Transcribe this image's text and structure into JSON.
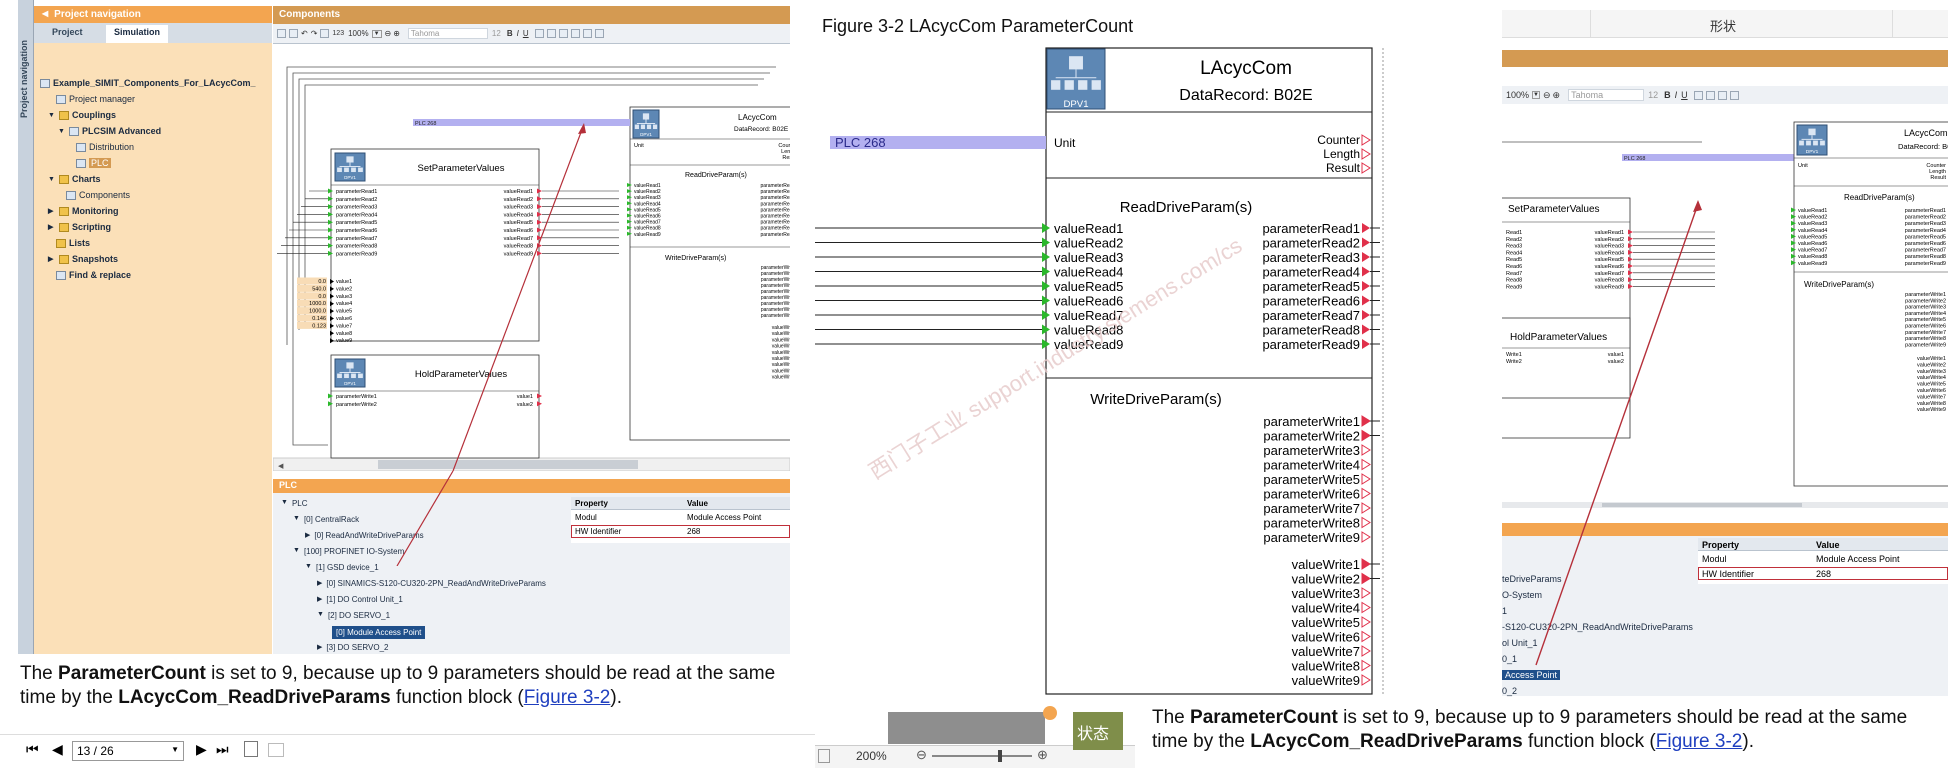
{
  "left_ide": {
    "nav_header": "Project navigation",
    "nav_vertical": "Project navigation",
    "tabs": [
      "Project",
      "Simulation"
    ],
    "tree": [
      {
        "label": "Example_SIMIT_Components_For_LAcycCom_",
        "bold": true
      },
      {
        "label": "Project manager",
        "bold": false
      },
      {
        "label": "Couplings",
        "bold": true
      },
      {
        "label": "PLCSIM Advanced",
        "bold": true
      },
      {
        "label": "Distribution",
        "bold": false
      },
      {
        "label": "PLC",
        "bold": false
      },
      {
        "label": "Charts",
        "bold": true
      },
      {
        "label": "Components",
        "bold": false
      },
      {
        "label": "Monitoring",
        "bold": true
      },
      {
        "label": "Scripting",
        "bold": true
      },
      {
        "label": "Lists",
        "bold": true
      },
      {
        "label": "Snapshots",
        "bold": true
      },
      {
        "label": "Find & replace",
        "bold": true
      }
    ],
    "components_header": "Components",
    "zoom": "100%",
    "font_name": "Tahoma",
    "font_size": "12",
    "toolbar_misc": {
      "num": "123",
      "b": "B",
      "i": "I",
      "u": "U"
    },
    "set_block": {
      "title": "SetParameterValues",
      "badge": "DPV1",
      "inputs": [
        "parameterRead1",
        "parameterRead2",
        "parameterRead3",
        "parameterRead4",
        "parameterRead5",
        "parameterRead6",
        "parameterRead7",
        "parameterRead8",
        "parameterRead9"
      ],
      "outputs": [
        "valueRead1",
        "valueRead2",
        "valueRead3",
        "valueRead4",
        "valueRead5",
        "valueRead6",
        "valueRead7",
        "valueRead8",
        "valueRead9"
      ]
    },
    "value_numbers": [
      "0.0",
      "540.0",
      "0.0",
      "1000.0",
      "1000.0",
      "0.146",
      "0.123"
    ],
    "value_labels": [
      "value1",
      "value2",
      "value3",
      "value4",
      "value5",
      "value6",
      "value7",
      "value8",
      "value9"
    ],
    "hold_block": {
      "title": "HoldParameterValues",
      "badge": "DPV1",
      "inputs": [
        "parameterWrite1",
        "parameterWrite2"
      ],
      "outputs": [
        "value1",
        "value2"
      ]
    },
    "lacyc": {
      "title": "LAcycCom",
      "subtitle": "DataRecord: B02E",
      "badge": "DPV1",
      "unit": "Unit",
      "counters": [
        "Counter",
        "Length",
        "Result"
      ],
      "read_title": "ReadDriveParam(s)",
      "read_in": [
        "valueRead1",
        "valueRead2",
        "valueRead3",
        "valueRead4",
        "valueRead5",
        "valueRead6",
        "valueRead7",
        "valueRead8",
        "valueRead9"
      ],
      "read_out": [
        "parameterRead1",
        "parameterRead2",
        "parameterRead3",
        "parameterRead4",
        "parameterRead5",
        "parameterRead6",
        "parameterRead7",
        "parameterRead8",
        "parameterRead9"
      ],
      "write_title": "WriteDriveParam(s)",
      "write_out": [
        "parameterWrite1",
        "parameterWrite2",
        "parameterWrite3",
        "parameterWrite4",
        "parameterWrite5",
        "parameterWrite6",
        "parameterWrite7",
        "parameterWrite8",
        "parameterWrite9"
      ],
      "value_out": [
        "valueWrite1",
        "valueWrite2",
        "valueWrite3",
        "valueWrite4",
        "valueWrite5",
        "valueWrite6",
        "valueWrite7",
        "valueWrite8",
        "valueWrite9"
      ]
    },
    "plc_tag": "PLC 268",
    "plc_panel_header": "PLC",
    "plc_tree": [
      "PLC",
      "[0] CentralRack",
      "[0] ReadAndWriteDriveParams",
      "[100] PROFINET IO-System",
      "[1] GSD device_1",
      "[0] SINAMICS-S120-CU320-2PN_ReadAndWriteDriveParams",
      "[1] DO Control Unit_1",
      "[2] DO SERVO_1",
      "[0] Module Access Point",
      "[3] DO SERVO_2"
    ],
    "props": {
      "col_property": "Property",
      "col_value": "Value",
      "rows": [
        {
          "p": "Modul",
          "v": "Module Access Point"
        },
        {
          "p": "HW Identifier",
          "v": "268"
        }
      ]
    },
    "caption_a": "The ",
    "caption_b": "ParameterCount",
    "caption_c": " is set to 9, because up to 9 parameters should be read at the same time by the ",
    "caption_d": "LAcycCom_ReadDriveParams",
    "caption_e": " function block (",
    "caption_link": "Figure 3-2",
    "caption_f": ").",
    "page_field": "13 / 26"
  },
  "figure": {
    "title": "Figure 3-2 LAcycCom ParameterCount",
    "watermark": "西门子工业 support.industry.siemens.com/cs"
  },
  "right": {
    "header_label": "形状",
    "zoom": "100%",
    "font_name": "Tahoma",
    "font_size": "12",
    "set_title": "SetParameterValues",
    "hold_title": "HoldParameterValues",
    "tree_fragments": [
      "teDriveParams",
      "O-System",
      "1",
      "-S120-CU320-2PN_ReadAndWriteDriveParams",
      "ol Unit_1",
      "0_1",
      "Access Point",
      "0_2"
    ],
    "viewer_zoom": "200%",
    "status_text": "状态"
  }
}
